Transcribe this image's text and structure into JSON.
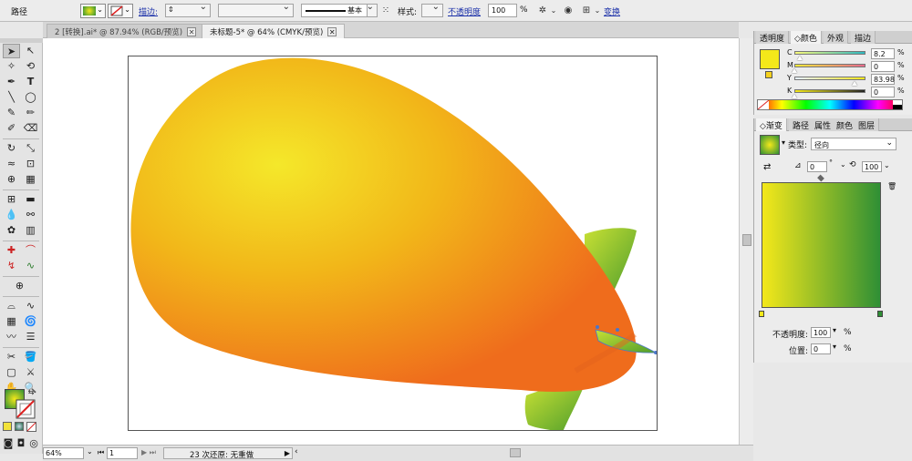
{
  "control_bar": {
    "object_label": "路径",
    "stroke_link": "描边:",
    "stroke_style_label": "基本",
    "style_label": "样式:",
    "opacity_link": "不透明度",
    "opacity_value": "100",
    "opacity_unit": "%",
    "transform_link": "变换"
  },
  "tabs": [
    {
      "label": "2 [转换].ai* @ 87.94% (RGB/预览)",
      "active": false
    },
    {
      "label": "未标题-5* @ 64% (CMYK/预览)",
      "active": true
    }
  ],
  "color_panel": {
    "tabs": [
      "透明度",
      "颜色",
      "外观",
      "描边"
    ],
    "active_tab": "颜色",
    "fill_color": "#f4e81a",
    "channels": [
      {
        "name": "C",
        "value": "8.2",
        "level": 0.082
      },
      {
        "name": "M",
        "value": "0",
        "level": 0
      },
      {
        "name": "Y",
        "value": "83.98",
        "level": 0.8398
      },
      {
        "name": "K",
        "value": "0",
        "level": 0
      }
    ]
  },
  "gradient_panel": {
    "tabs": [
      "渐变",
      "路径",
      "属性",
      "颜色",
      "图层"
    ],
    "active_tab": "渐变",
    "type_label": "类型:",
    "type_value": "径向",
    "angle_value": "0",
    "angle_unit": "°",
    "ratio_value": "100",
    "ratio_unit": "%",
    "opacity_label": "不透明度:",
    "opacity_value": "100",
    "opacity_unit": "%",
    "position_label": "位置:",
    "position_value": "0",
    "position_unit": "%",
    "stop_colors": [
      "#f4e81a",
      "#2f8f35"
    ]
  },
  "status_bar": {
    "zoom": "64%",
    "artboard": "1",
    "undo_text": "23 次还原: 无重做"
  },
  "artwork": {
    "body_gradient": [
      "#f4e82a",
      "#f2b719",
      "#ef6c1c"
    ],
    "fin_gradient": [
      "#c8e034",
      "#4f9e2c"
    ]
  }
}
